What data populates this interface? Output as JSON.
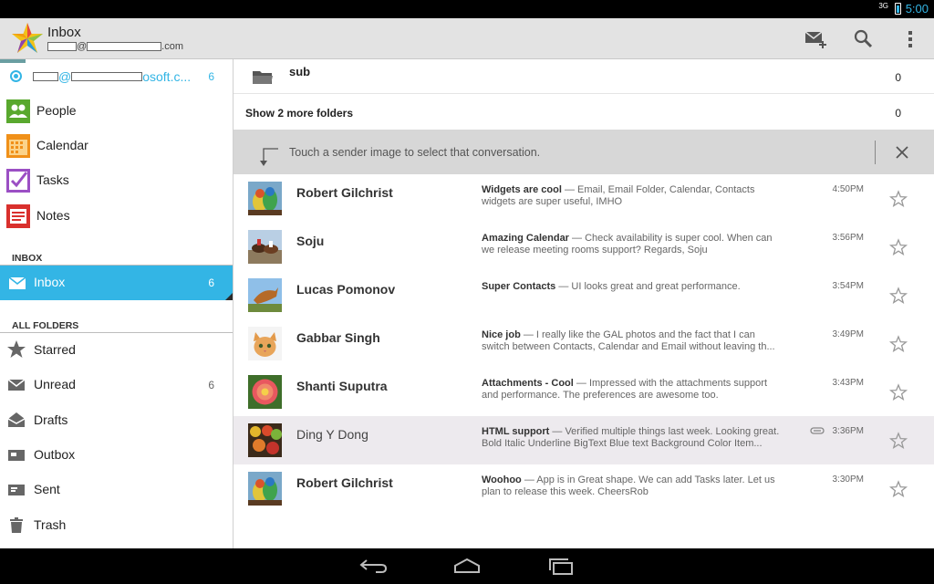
{
  "status": {
    "network": "3G",
    "time": "5:00"
  },
  "actionbar": {
    "title": "Inbox",
    "account_domain": ".com",
    "actions": [
      "compose-icon",
      "search-icon",
      "overflow-menu-icon"
    ]
  },
  "drawer": {
    "account": {
      "text": "osoft.c...",
      "at": "@",
      "count": "6"
    },
    "apps": [
      {
        "label": "People",
        "icon": "people-icon"
      },
      {
        "label": "Calendar",
        "icon": "calendar-icon"
      },
      {
        "label": "Tasks",
        "icon": "tasks-icon"
      },
      {
        "label": "Notes",
        "icon": "notes-icon"
      }
    ],
    "inbox_header": "INBOX",
    "inbox_item": {
      "label": "Inbox",
      "count": "6"
    },
    "folders_header": "ALL FOLDERS",
    "folders": [
      {
        "label": "Starred",
        "count": "",
        "icon": "star-icon"
      },
      {
        "label": "Unread",
        "count": "6",
        "icon": "unread-icon"
      },
      {
        "label": "Drafts",
        "count": "",
        "icon": "drafts-icon"
      },
      {
        "label": "Outbox",
        "count": "",
        "icon": "outbox-icon"
      },
      {
        "label": "Sent",
        "count": "",
        "icon": "sent-icon"
      },
      {
        "label": "Trash",
        "count": "",
        "icon": "trash-icon"
      }
    ]
  },
  "content": {
    "subfolder": {
      "label": "sub",
      "count": "0"
    },
    "more_folders": {
      "label": "Show 2 more folders",
      "count": "0"
    },
    "tip": "Touch a sender image to select that conversation.",
    "conversations": [
      {
        "sender": "Robert Gilchrist",
        "subject": "Widgets are cool",
        "snippet": " — Email, Email Folder, Calendar, Contacts widgets are super useful, IMHO",
        "time": "4:50PM",
        "read": false,
        "attachment": false,
        "avatar": "birds"
      },
      {
        "sender": "Soju",
        "subject": "Amazing Calendar",
        "snippet": " — Check availability is super cool. When can we release meeting rooms support? Regards, Soju",
        "time": "3:56PM",
        "read": false,
        "attachment": false,
        "avatar": "horses"
      },
      {
        "sender": "Lucas Pomonov",
        "subject": "Super Contacts",
        "snippet": " — UI looks great and great performance.",
        "time": "3:54PM",
        "read": false,
        "attachment": false,
        "avatar": "dog"
      },
      {
        "sender": "Gabbar Singh",
        "subject": "Nice job",
        "snippet": " — I really like the GAL photos and the fact that I can switch between Contacts, Calendar and Email without leaving th...",
        "time": "3:49PM",
        "read": false,
        "attachment": false,
        "avatar": "kitten"
      },
      {
        "sender": "Shanti Suputra",
        "subject": "Attachments - Cool",
        "snippet": " — Impressed with the attachments support and performance. The preferences are awesome too.",
        "time": "3:43PM",
        "read": false,
        "attachment": false,
        "avatar": "flower"
      },
      {
        "sender": "Ding Y Dong",
        "subject": "HTML support",
        "snippet": " — Verified multiple things last week. Looking great. Bold Italic Underline BigText Blue text Background Color Item...",
        "time": "3:36PM",
        "read": true,
        "attachment": true,
        "avatar": "fruit"
      },
      {
        "sender": "Robert Gilchrist",
        "subject": "Woohoo",
        "snippet": " — App is in Great shape. We can add Tasks later. Let us plan to release this week. CheersRob",
        "time": "3:30PM",
        "read": false,
        "attachment": false,
        "avatar": "birds"
      }
    ]
  },
  "colors": {
    "accent": "#33b5e5",
    "actionbar": "#e3e3e3",
    "tip_bg": "#d7d7d7",
    "selected_row": "#edeaee"
  }
}
